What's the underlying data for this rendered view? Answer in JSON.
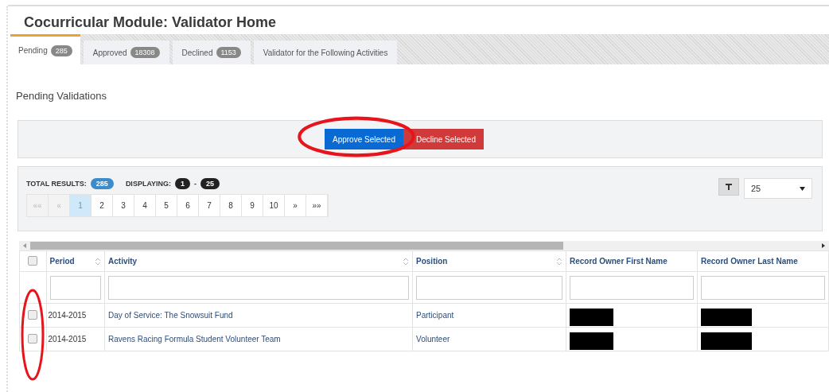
{
  "title": "Cocurricular Module: Validator Home",
  "tabs": [
    {
      "label": "Pending",
      "count": "285",
      "selected": true
    },
    {
      "label": "Approved",
      "count": "18308",
      "selected": false
    },
    {
      "label": "Declined",
      "count": "1153",
      "selected": false
    },
    {
      "label": "Validator for the Following Activities",
      "selected": false
    }
  ],
  "section_title": "Pending Validations",
  "actions": [
    {
      "label": "Approve Selected",
      "kind": "primary"
    },
    {
      "label": "Decline Selected",
      "kind": "danger"
    }
  ],
  "results": {
    "total_label": "TOTAL RESULTS:",
    "total": "285",
    "displaying_label": "DISPLAYING:",
    "from": "1",
    "separator": "-",
    "to": "25",
    "page_size": "25"
  },
  "pager": [
    {
      "label": "««",
      "disabled": true,
      "selected": false
    },
    {
      "label": "«",
      "disabled": true,
      "selected": false
    },
    {
      "label": "1",
      "disabled": false,
      "selected": true
    },
    {
      "label": "2",
      "disabled": false,
      "selected": false
    },
    {
      "label": "3",
      "disabled": false,
      "selected": false
    },
    {
      "label": "4",
      "disabled": false,
      "selected": false
    },
    {
      "label": "5",
      "disabled": false,
      "selected": false
    },
    {
      "label": "6",
      "disabled": false,
      "selected": false
    },
    {
      "label": "7",
      "disabled": false,
      "selected": false
    },
    {
      "label": "8",
      "disabled": false,
      "selected": false
    },
    {
      "label": "9",
      "disabled": false,
      "selected": false
    },
    {
      "label": "10",
      "disabled": false,
      "selected": false
    },
    {
      "label": "»",
      "disabled": false,
      "selected": false
    },
    {
      "label": "»»",
      "disabled": false,
      "selected": false
    }
  ],
  "table": {
    "all_checked": false,
    "columns": [
      {
        "label": "Period",
        "sortable": true
      },
      {
        "label": "Activity",
        "sortable": true
      },
      {
        "label": "Position",
        "sortable": true
      },
      {
        "label": "Record Owner First Name",
        "sortable": false
      },
      {
        "label": "Record Owner Last Name",
        "sortable": false
      }
    ],
    "rows": [
      {
        "checked": false,
        "period": "2014-2015",
        "activity": "Day of Service: The Snowsuit Fund",
        "position": "Participant"
      },
      {
        "checked": false,
        "period": "2014-2015",
        "activity": "Ravens Racing Formula Student Volunteer Team",
        "position": "Volunteer"
      }
    ]
  }
}
